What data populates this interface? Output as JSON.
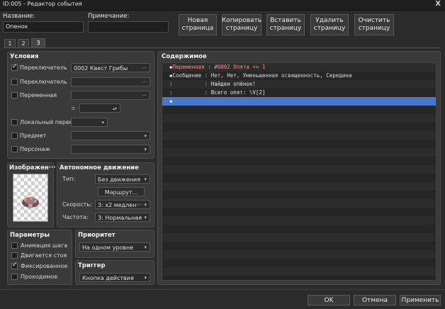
{
  "window": {
    "title": "ID:005 - Редактор события",
    "close_label": "X"
  },
  "header": {
    "name_label": "Название:",
    "name_value": "Опенок",
    "note_label": "Примечание:",
    "note_value": "",
    "buttons": [
      {
        "label": "Новая\nстраница"
      },
      {
        "label": "Копировать\nстраницу"
      },
      {
        "label": "Вставить\nстраницу"
      },
      {
        "label": "Удалить\nстраницу"
      },
      {
        "label": "Очистить\nстраницу"
      }
    ]
  },
  "tabs": [
    "1",
    "2",
    "3"
  ],
  "conditions": {
    "title": "Условия",
    "switch1": {
      "label": "Переключатель",
      "value": "0002 Квест Грибы",
      "checked": true
    },
    "switch2": {
      "label": "Переключатель",
      "value": "",
      "checked": false
    },
    "variable": {
      "label": "Переменная",
      "value": "",
      "checked": false
    },
    "variable_cmp": "≥",
    "self_switch": {
      "label": "Локальный перек···",
      "checked": false
    },
    "item": {
      "label": "Предмет",
      "checked": false
    },
    "actor": {
      "label": "Персонаж",
      "checked": false
    },
    "ellipsis": "···"
  },
  "image": {
    "title": "Изображен···"
  },
  "autonomous": {
    "title": "Автономное движение",
    "type_label": "Тип:",
    "type_value": "Без движения",
    "route_label": "Маршрут...",
    "speed_label": "Скорость:",
    "speed_value": "3: x2 медлен···",
    "freq_label": "Частота:",
    "freq_value": "3: Нормальная"
  },
  "options": {
    "title": "Параметры",
    "items": [
      {
        "label": "Анимация шага",
        "checked": false
      },
      {
        "label": "Двигается стоя",
        "checked": false
      },
      {
        "label": "Фиксированное",
        "checked": true
      },
      {
        "label": "Проходимое",
        "checked": false
      }
    ]
  },
  "priority": {
    "title": "Приоритет",
    "value": "На одном уровне"
  },
  "trigger": {
    "title": "Триггер",
    "value": "Кнопка действия"
  },
  "contents": {
    "title": "Содержимое",
    "lines": [
      {
        "prefix": "◆",
        "cmd": "Переменная",
        "sep": " : ",
        "text": "#0002 Опята += 1",
        "color": "#ff8a8a",
        "cmdcolor": "#ff8a8a"
      },
      {
        "prefix": "◆",
        "cmd": "Сообщение",
        "sep": " : ",
        "text": "Нет, Нет, Уменьшенная освещенность, Середина",
        "color": "#d8d8d8",
        "cmdcolor": "#d8d8d8"
      },
      {
        "prefix": " :",
        "cmd": "",
        "sep": "          : ",
        "text": "Найден опёнок!",
        "color": "#e8e8e8",
        "cmdcolor": "#d8d8d8"
      },
      {
        "prefix": " :",
        "cmd": "",
        "sep": "          : ",
        "text": "Всего опят: \\V[2]",
        "color": "#e8e8e8",
        "cmdcolor": "#d8d8d8"
      },
      {
        "prefix": "◆",
        "cmd": "",
        "sep": "",
        "text": "",
        "color": "#ffffff",
        "cmdcolor": "#ffffff"
      }
    ]
  },
  "footer": {
    "ok": "OK",
    "cancel": "Отмена",
    "apply": "Применить"
  },
  "colors": {
    "selection": "#4a78c8",
    "background": "#2b2b2b"
  }
}
